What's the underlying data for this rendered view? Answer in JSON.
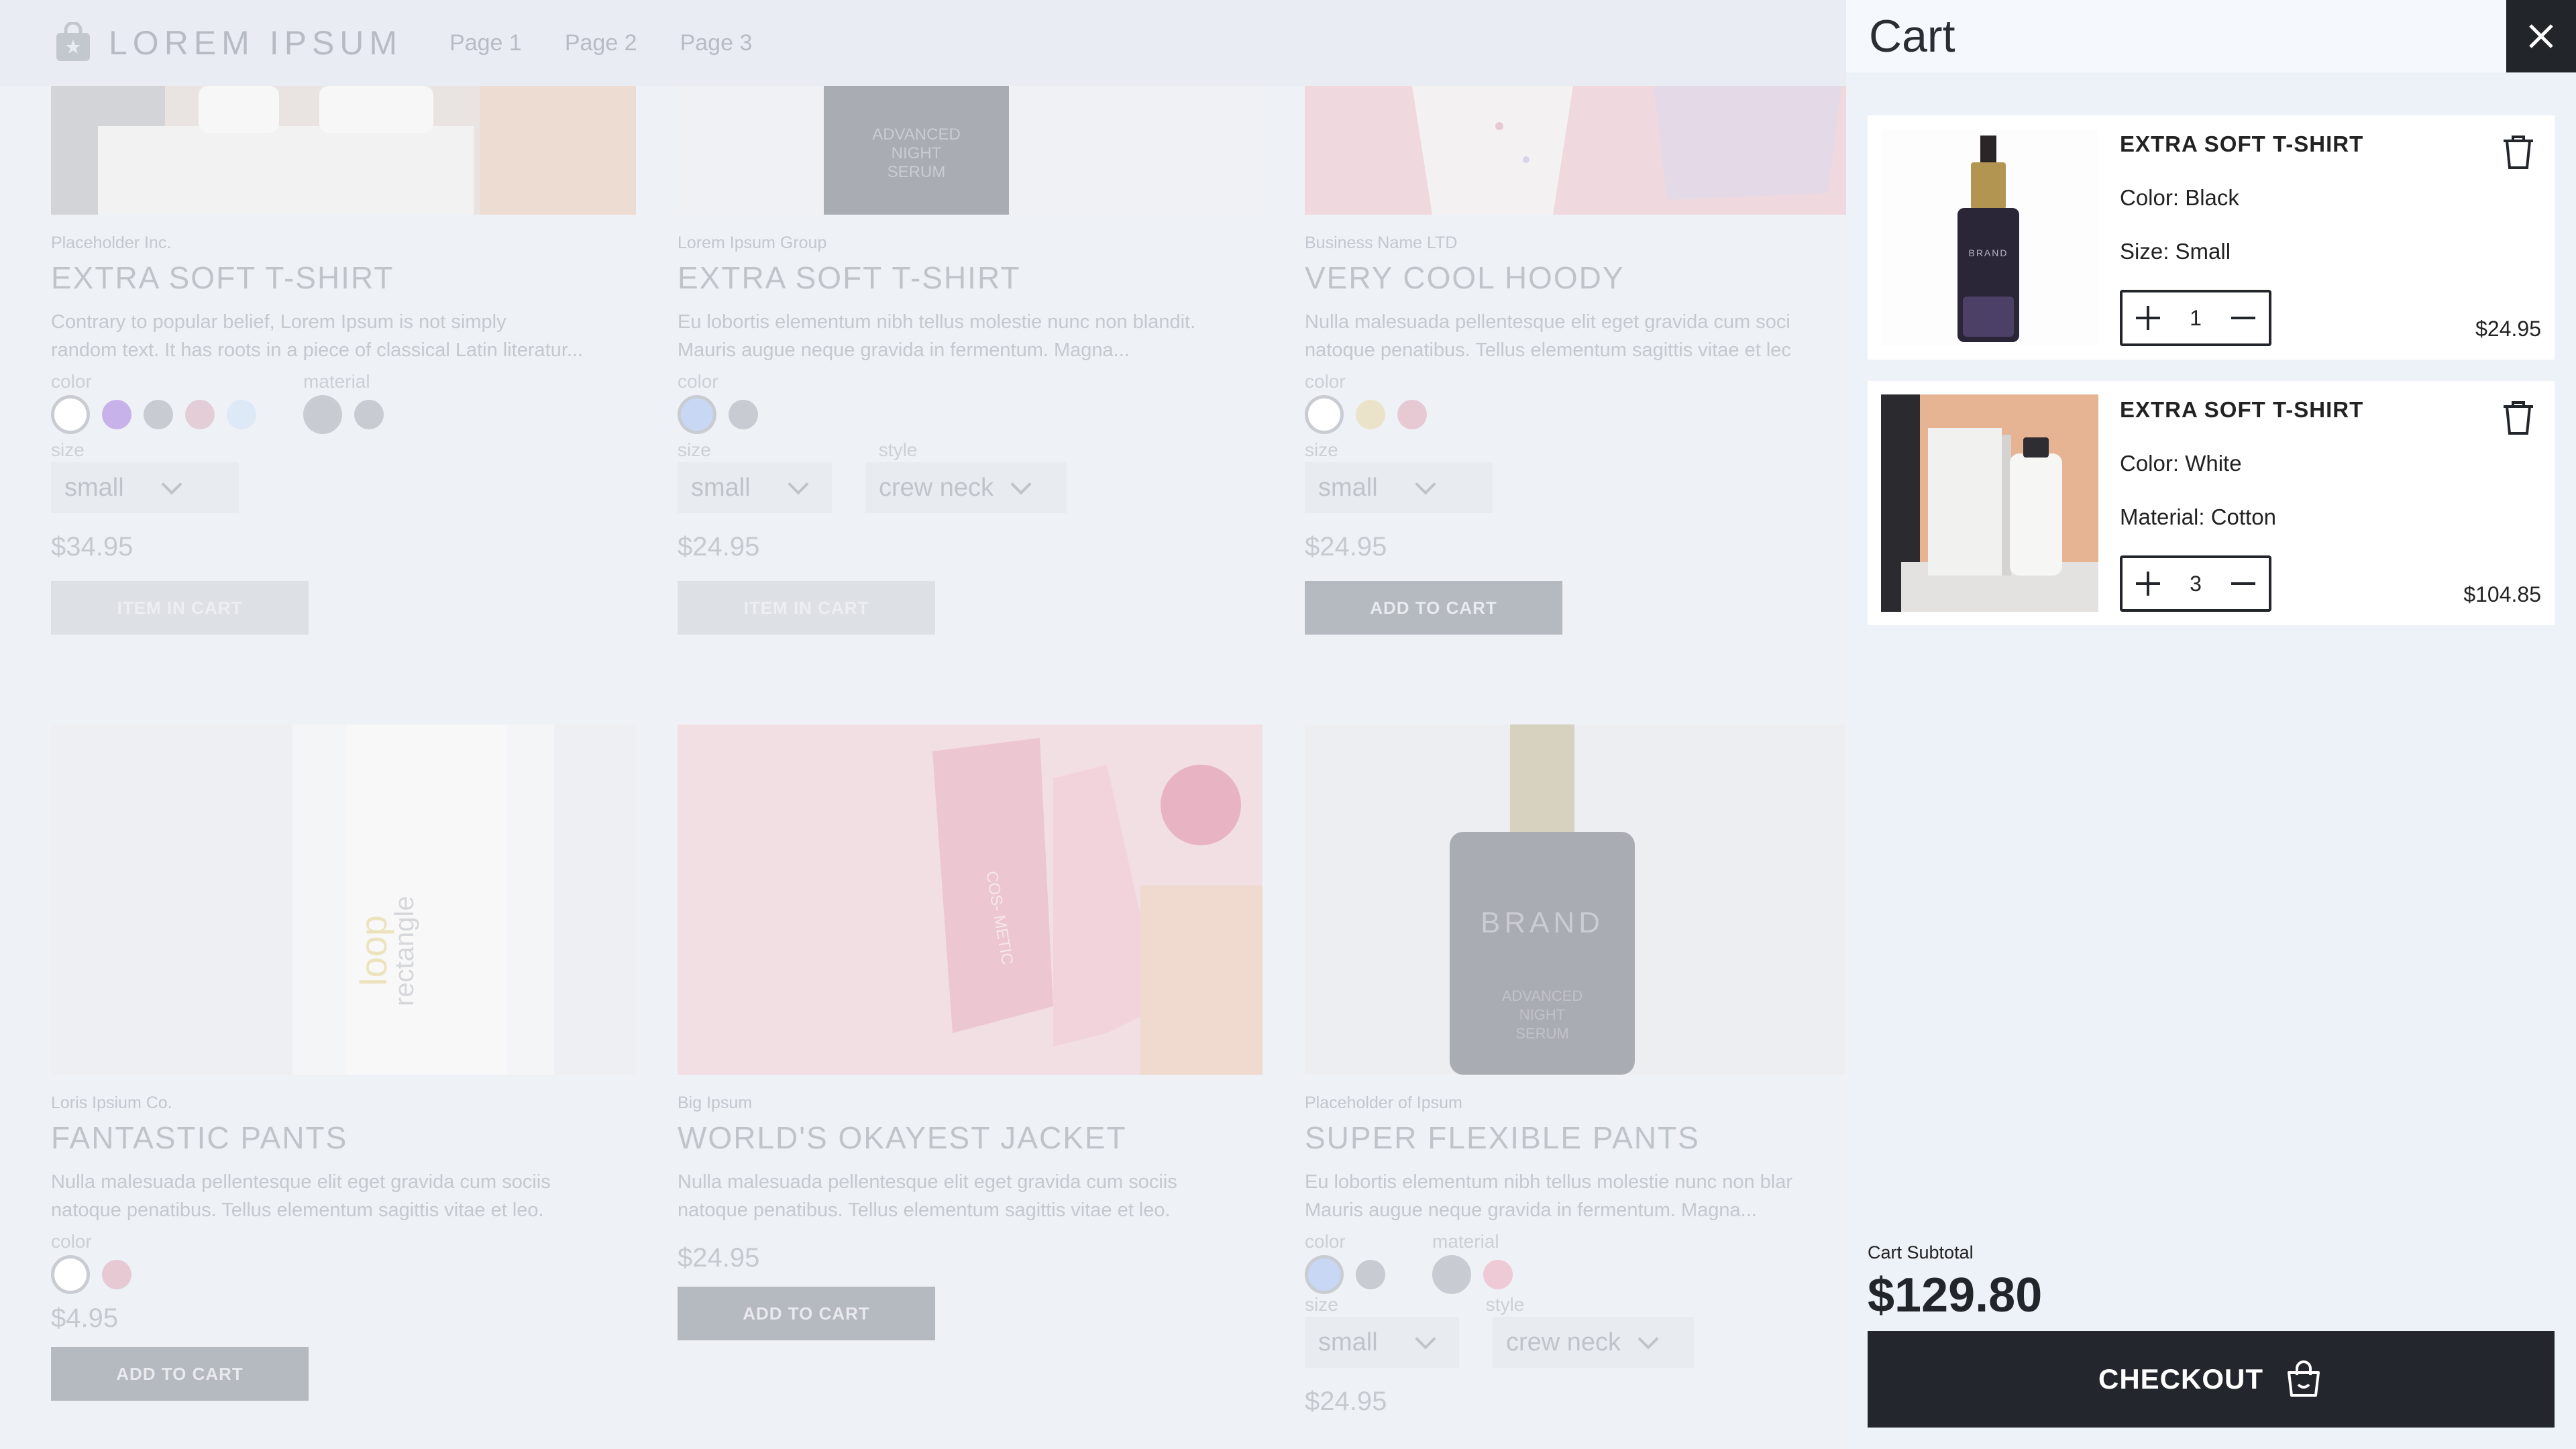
{
  "header": {
    "logo_text": "LOREM IPSUM",
    "nav": [
      "Page 1",
      "Page 2",
      "Page 3"
    ]
  },
  "products": [
    {
      "brand": "Placeholder Inc.",
      "title": "EXTRA SOFT T-SHIRT",
      "desc": [
        "Contrary to popular belief, Lorem Ipsum is not simply",
        "random text. It has roots in a piece of classical Latin literatur..."
      ],
      "option_labels": [
        "color",
        "material"
      ],
      "colors": [
        "#ffffff",
        "#c7b3ea",
        "#c8cbd1",
        "#e3cdd7",
        "#dde9f6"
      ],
      "materials": [
        "#c8cbd1",
        "#c8cbd1"
      ],
      "size_label": "size",
      "size": "small",
      "price": "$34.95",
      "button": "ITEM IN CART"
    },
    {
      "brand": "Lorem Ipsum Group",
      "title": "EXTRA SOFT T-SHIRT",
      "desc": [
        "Eu lobortis elementum nibh tellus molestie nunc non blandit.",
        "Mauris augue neque gravida in fermentum. Magna..."
      ],
      "option_labels": [
        "color"
      ],
      "colors": [
        "#c8d8f4",
        "#c8cbd1"
      ],
      "size_label": "size",
      "style_label": "style",
      "size": "small",
      "style": "crew neck",
      "price": "$24.95",
      "button": "ITEM IN CART"
    },
    {
      "brand": "Business Name LTD",
      "title": "VERY COOL HOODY",
      "desc": [
        "Nulla malesuada pellentesque elit eget gravida cum soci",
        "natoque penatibus. Tellus elementum sagittis vitae et lec"
      ],
      "option_labels": [
        "color"
      ],
      "colors": [
        "#ffffff",
        "#ebe3c9",
        "#e7c9d4"
      ],
      "size_label": "size",
      "size": "small",
      "price": "$24.95",
      "button": "ADD TO CART"
    },
    {
      "brand": "Loris Ipsium Co.",
      "title": "FANTASTIC PANTS",
      "desc": [
        "Nulla malesuada pellentesque elit eget gravida cum sociis",
        "natoque penatibus. Tellus elementum sagittis vitae et leo."
      ],
      "option_labels": [
        "color"
      ],
      "colors": [
        "#ffffff",
        "#e7c9d4"
      ],
      "price": "$4.95",
      "button": "ADD TO CART"
    },
    {
      "brand": "Big Ipsum",
      "title": "WORLD'S OKAYEST JACKET",
      "desc": [
        "Nulla malesuada pellentesque elit eget gravida cum sociis",
        "natoque penatibus. Tellus elementum sagittis vitae et leo."
      ],
      "price": "$24.95",
      "button": "ADD TO CART"
    },
    {
      "brand": "Placeholder of Ipsum",
      "title": "SUPER FLEXIBLE PANTS",
      "desc": [
        "Eu lobortis elementum nibh tellus molestie nunc non blar",
        "Mauris augue neque gravida in fermentum. Magna..."
      ],
      "option_labels": [
        "color",
        "material"
      ],
      "colors": [
        "#c8d8f4",
        "#c8cbd1"
      ],
      "materials": [
        "#c8cbd1",
        "#eec9d6"
      ],
      "size_label": "size",
      "style_label": "style",
      "size": "small",
      "style": "crew neck",
      "price": "$24.95"
    }
  ],
  "cart": {
    "title": "Cart",
    "items": [
      {
        "name": "EXTRA SOFT T-SHIRT",
        "attr1": "Color: Black",
        "attr2": "Size: Small",
        "quantity": "1",
        "price": "$24.95",
        "image_text": "BRAND"
      },
      {
        "name": "EXTRA SOFT T-SHIRT",
        "attr1": "Color: White",
        "attr2": "Material: Cotton",
        "quantity": "3",
        "price": "$104.85"
      }
    ],
    "subtotal_label": "Cart Subtotal",
    "subtotal": "$129.80",
    "checkout_label": "CHECKOUT"
  },
  "image_text": {
    "serum_line1": "ADVANCED",
    "serum_line2": "NIGHT",
    "serum_line3": "SERUM",
    "brand": "BRAND",
    "cosmetic": "COS-\nMETIC",
    "loop": "loop",
    "rectangle": "rectangle"
  },
  "colors": {
    "accent_dark": "#22262b",
    "panel_bg": "#edf2f9",
    "overlay_bg": "#eef1f6"
  }
}
